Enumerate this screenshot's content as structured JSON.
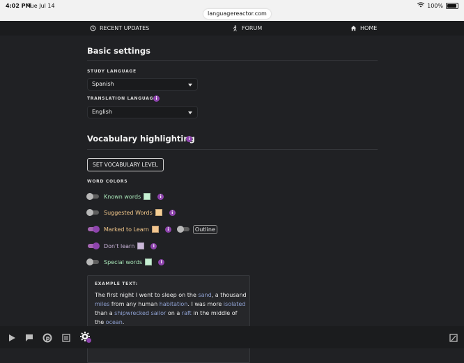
{
  "status": {
    "time": "4:02 PM",
    "date": "Tue Jul 14",
    "battery": "100%"
  },
  "browser": {
    "url": "languagereactor.com"
  },
  "topnav": {
    "items": [
      {
        "label": "RECENT UPDATES",
        "icon": "history-icon"
      },
      {
        "label": "FORUM",
        "icon": "person-icon"
      },
      {
        "label": "HOME",
        "icon": "home-icon"
      }
    ]
  },
  "basic": {
    "title": "Basic settings",
    "study_label": "STUDY LANGUAGE",
    "study_value": "Spanish",
    "translation_label": "TRANSLATION LANGUAGE",
    "translation_value": "English"
  },
  "vocab": {
    "title": "Vocabulary highlighting",
    "button": "SET VOCABULARY LEVEL",
    "word_colors_label": "WORD COLORS",
    "rows": [
      {
        "label": "Known words",
        "on": false,
        "label_color": "#a8e6b8",
        "swatch": "#c6f0d3"
      },
      {
        "label": "Suggested Words",
        "on": false,
        "label_color": "#f2c78a",
        "swatch": "#f6cf95"
      },
      {
        "label": "Marked to Learn",
        "on": true,
        "label_color": "#f2c78a",
        "swatch": "#f3c690"
      },
      {
        "label": "Don't learn",
        "on": true,
        "label_color": "#c8b3d8",
        "swatch": "#cbb8d9"
      },
      {
        "label": "Special words",
        "on": false,
        "label_color": "#a8e6b8",
        "swatch": "#c6f0d3"
      }
    ],
    "outline_label": "Outline"
  },
  "example": {
    "title": "EXAMPLE TEXT:",
    "text_segments": [
      {
        "t": "The first night I went to sleep on the ",
        "hl": false
      },
      {
        "t": "sand",
        "hl": true
      },
      {
        "t": ", a thousand ",
        "hl": false
      },
      {
        "t": "miles",
        "hl": true
      },
      {
        "t": " from any human ",
        "hl": false
      },
      {
        "t": "habitation",
        "hl": true
      },
      {
        "t": ". I was more ",
        "hl": false
      },
      {
        "t": "isolated",
        "hl": true
      },
      {
        "t": " than a ",
        "hl": false
      },
      {
        "t": "shipwrecked sailor",
        "hl": true
      },
      {
        "t": " on a ",
        "hl": false
      },
      {
        "t": "raft",
        "hl": true
      },
      {
        "t": " in the middle of the ",
        "hl": false
      },
      {
        "t": "ocean",
        "hl": true
      },
      {
        "t": ".",
        "hl": false
      }
    ]
  },
  "colors": {
    "accent": "#8e44ad",
    "background": "#202124"
  },
  "bottom_bar": {
    "icons": [
      "play-icon",
      "chat-icon",
      "p-logo-icon",
      "list-icon",
      "settings-icon",
      "dictionary-icon"
    ]
  }
}
